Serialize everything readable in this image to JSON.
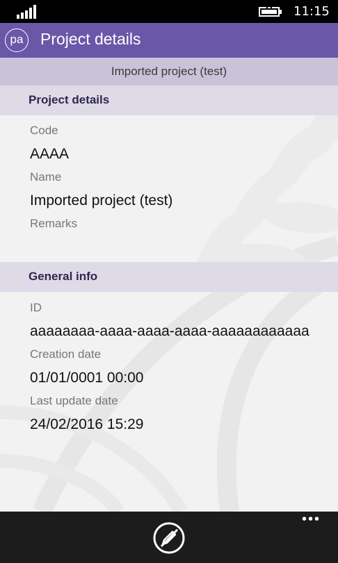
{
  "status_bar": {
    "time": "11:15",
    "signal_icon": "signal-bars-icon",
    "battery_icon": "battery-charging-icon"
  },
  "app_bar": {
    "logo_text": "pa",
    "title": "Project details"
  },
  "subheader": {
    "text": "Imported project (test)"
  },
  "sections": {
    "project": {
      "header": "Project details",
      "code_label": "Code",
      "code_value": "AAAA",
      "name_label": "Name",
      "name_value": "Imported project (test)",
      "remarks_label": "Remarks",
      "remarks_value": ""
    },
    "general": {
      "header": "General info",
      "id_label": "ID",
      "id_value": "aaaaaaaa-aaaa-aaaa-aaaa-aaaaaaaaaaaa",
      "created_label": "Creation date",
      "created_value": "01/01/0001 00:00",
      "updated_label": "Last update date",
      "updated_value": "24/02/2016 15:29"
    }
  },
  "app_bar_bottom": {
    "primary_icon": "edit-disabled-icon",
    "more_label": "•••"
  },
  "colors": {
    "accent": "#6b57a8",
    "subheader_bg": "#c9c3da",
    "section_bg": "#dedbe6",
    "bottom_bar": "#1c1c1c"
  }
}
